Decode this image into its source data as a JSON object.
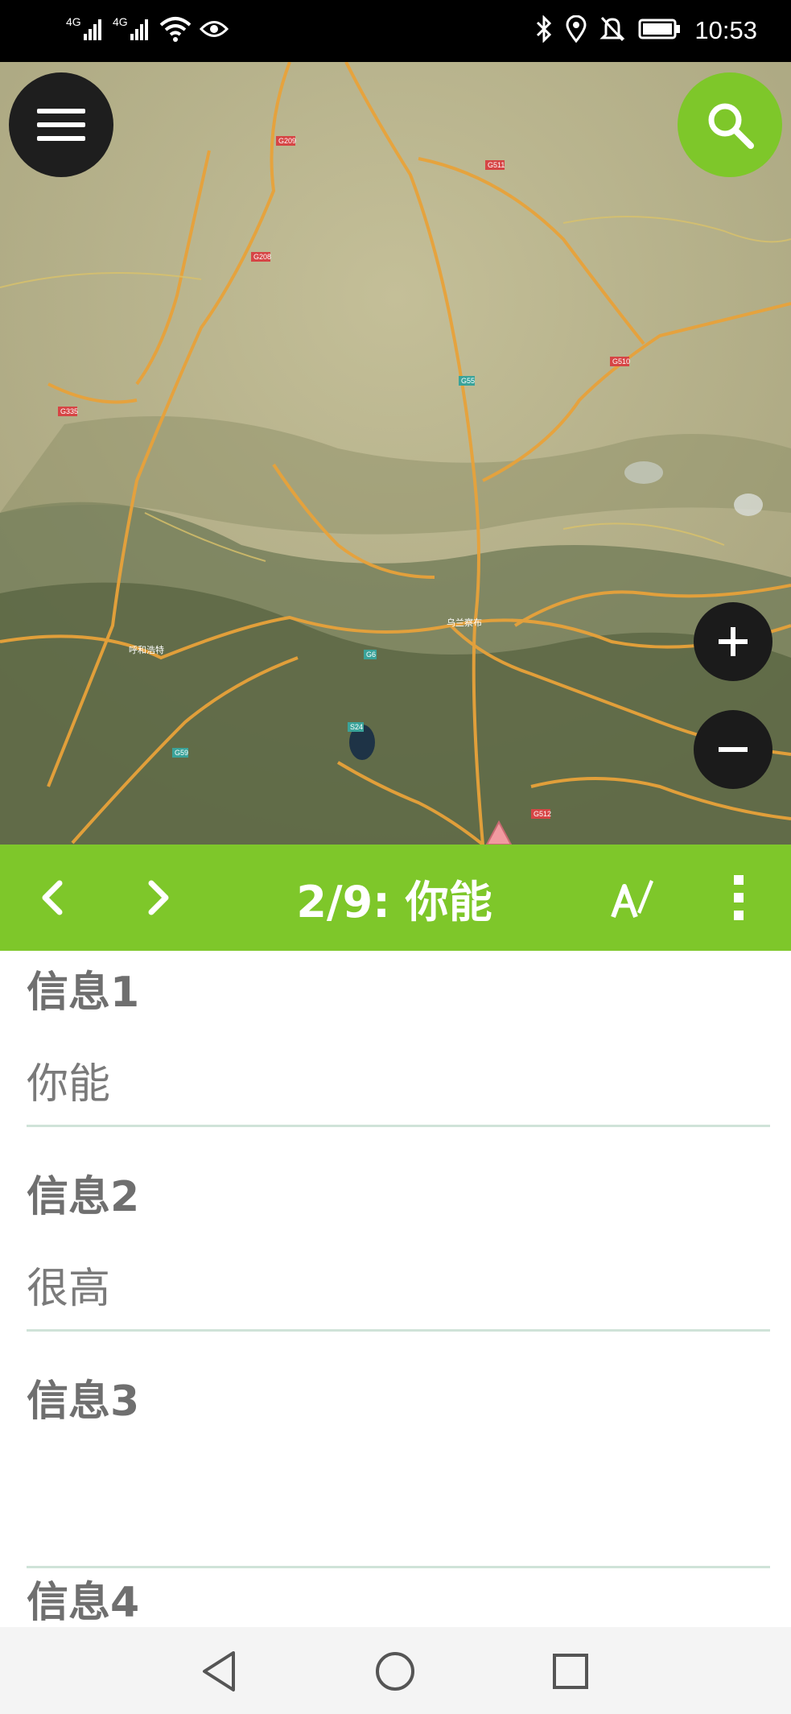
{
  "status_bar": {
    "signal1_label": "4G",
    "signal2_label": "4G",
    "time": "10:53",
    "icons": [
      "signal-icon",
      "signal-icon",
      "wifi-icon",
      "eye-icon",
      "bluetooth-icon",
      "location-icon",
      "mute-icon",
      "battery-icon"
    ]
  },
  "map": {
    "buttons": {
      "menu": "menu-icon",
      "search": "search-icon",
      "zoom_in": "plus-icon",
      "zoom_out": "minus-icon"
    },
    "labels": [
      {
        "text": "G209"
      },
      {
        "text": "G208"
      },
      {
        "text": "G335"
      },
      {
        "text": "G511"
      },
      {
        "text": "G55"
      },
      {
        "text": "G510"
      },
      {
        "text": "G6"
      },
      {
        "text": "G59"
      },
      {
        "text": "G512"
      },
      {
        "text": "S24"
      },
      {
        "text": "乌兰察布"
      },
      {
        "text": "呼和浩特"
      }
    ]
  },
  "toolbar": {
    "title": "2/9: 你能",
    "prev_icon": "chevron-left-icon",
    "next_icon": "chevron-right-icon",
    "edit_icon": "edit-text-icon",
    "more_icon": "more-vertical-icon",
    "accent": "#7ec72a"
  },
  "fields": [
    {
      "label": "信息1",
      "value": "你能"
    },
    {
      "label": "信息2",
      "value": "很高"
    },
    {
      "label": "信息3",
      "value": ""
    },
    {
      "label": "信息4",
      "value": ""
    }
  ],
  "nav_bar": {
    "back_icon": "back-triangle-icon",
    "home_icon": "home-circle-icon",
    "recents_icon": "recents-square-icon"
  }
}
